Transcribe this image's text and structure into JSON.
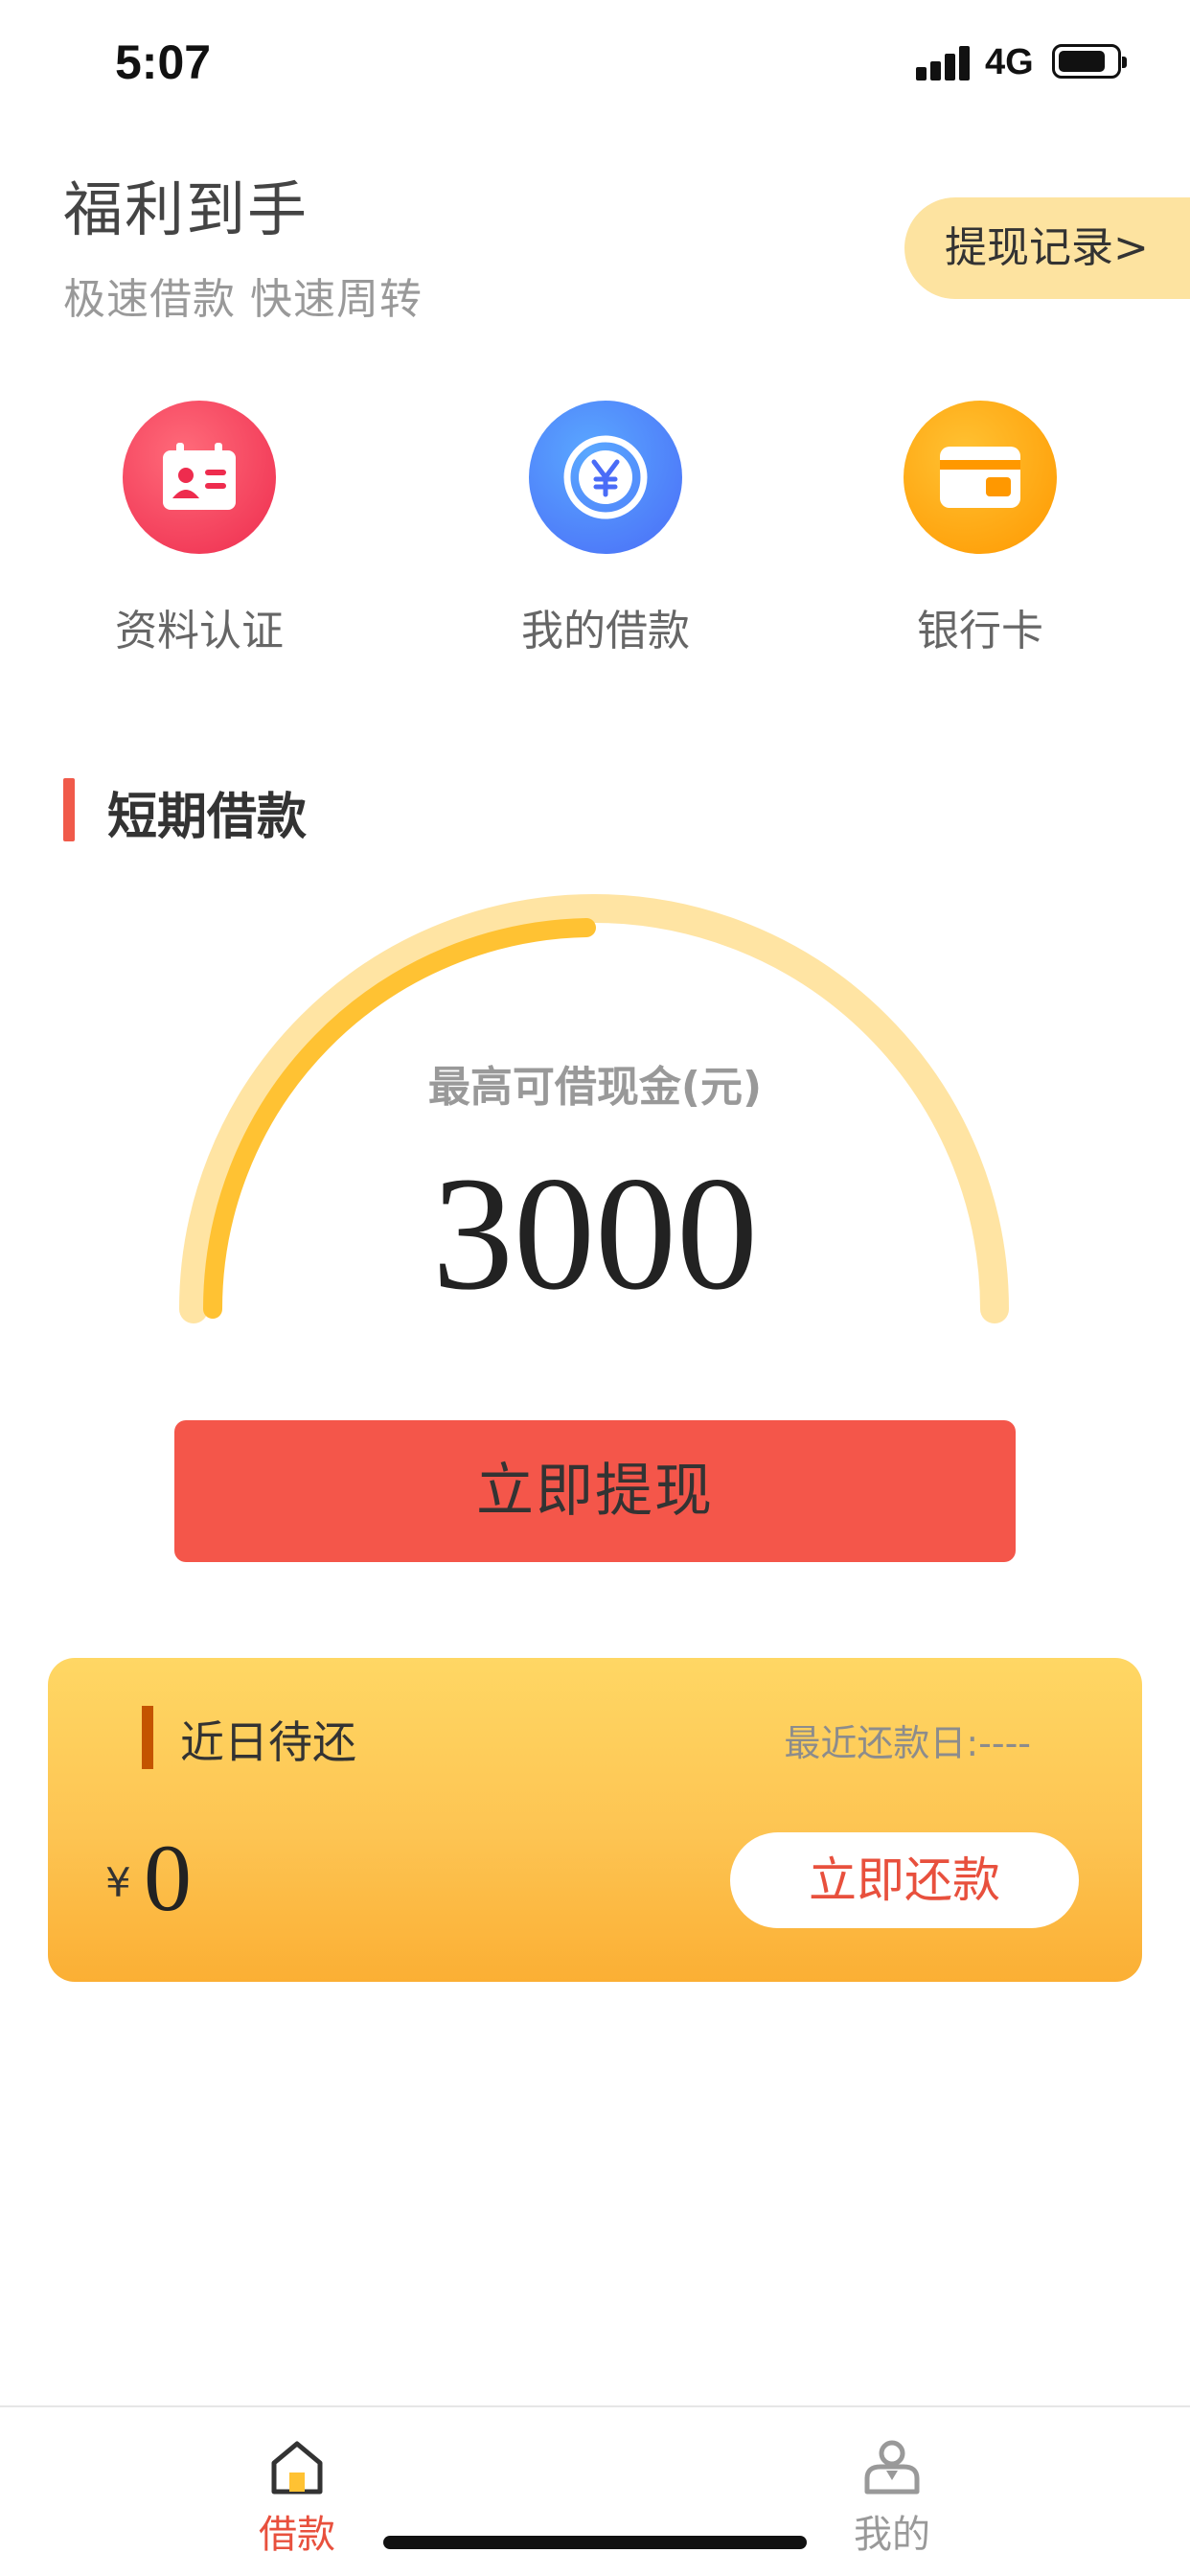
{
  "status_bar": {
    "time": "5:07",
    "network": "4G"
  },
  "header": {
    "title": "福利到手",
    "subtitle": "极速借款 快速周转",
    "record_button": "提现记录>"
  },
  "shortcuts": [
    {
      "label": "资料认证",
      "icon": "id-card-icon",
      "color": "#ee2c4e"
    },
    {
      "label": "我的借款",
      "icon": "yuan-coin-icon",
      "color": "#4a6cf7"
    },
    {
      "label": "银行卡",
      "icon": "bank-card-icon",
      "color": "#ff9800"
    }
  ],
  "loan": {
    "section_title": "短期借款",
    "gauge_label": "最高可借现金(元)",
    "max_amount": "3000",
    "withdraw_button": "立即提现"
  },
  "repayment": {
    "title": "近日待还",
    "recent_date": "最近还款日:----",
    "currency": "¥",
    "amount": "0",
    "repay_button": "立即还款"
  },
  "tabbar": {
    "items": [
      {
        "label": "借款",
        "icon": "home-icon",
        "active": true
      },
      {
        "label": "我的",
        "icon": "profile-icon",
        "active": false
      }
    ]
  },
  "colors": {
    "accent": "#f4564a",
    "gauge_track": "#ffe4a3",
    "gauge_progress": "#ffc233",
    "card": "#fdc452"
  }
}
